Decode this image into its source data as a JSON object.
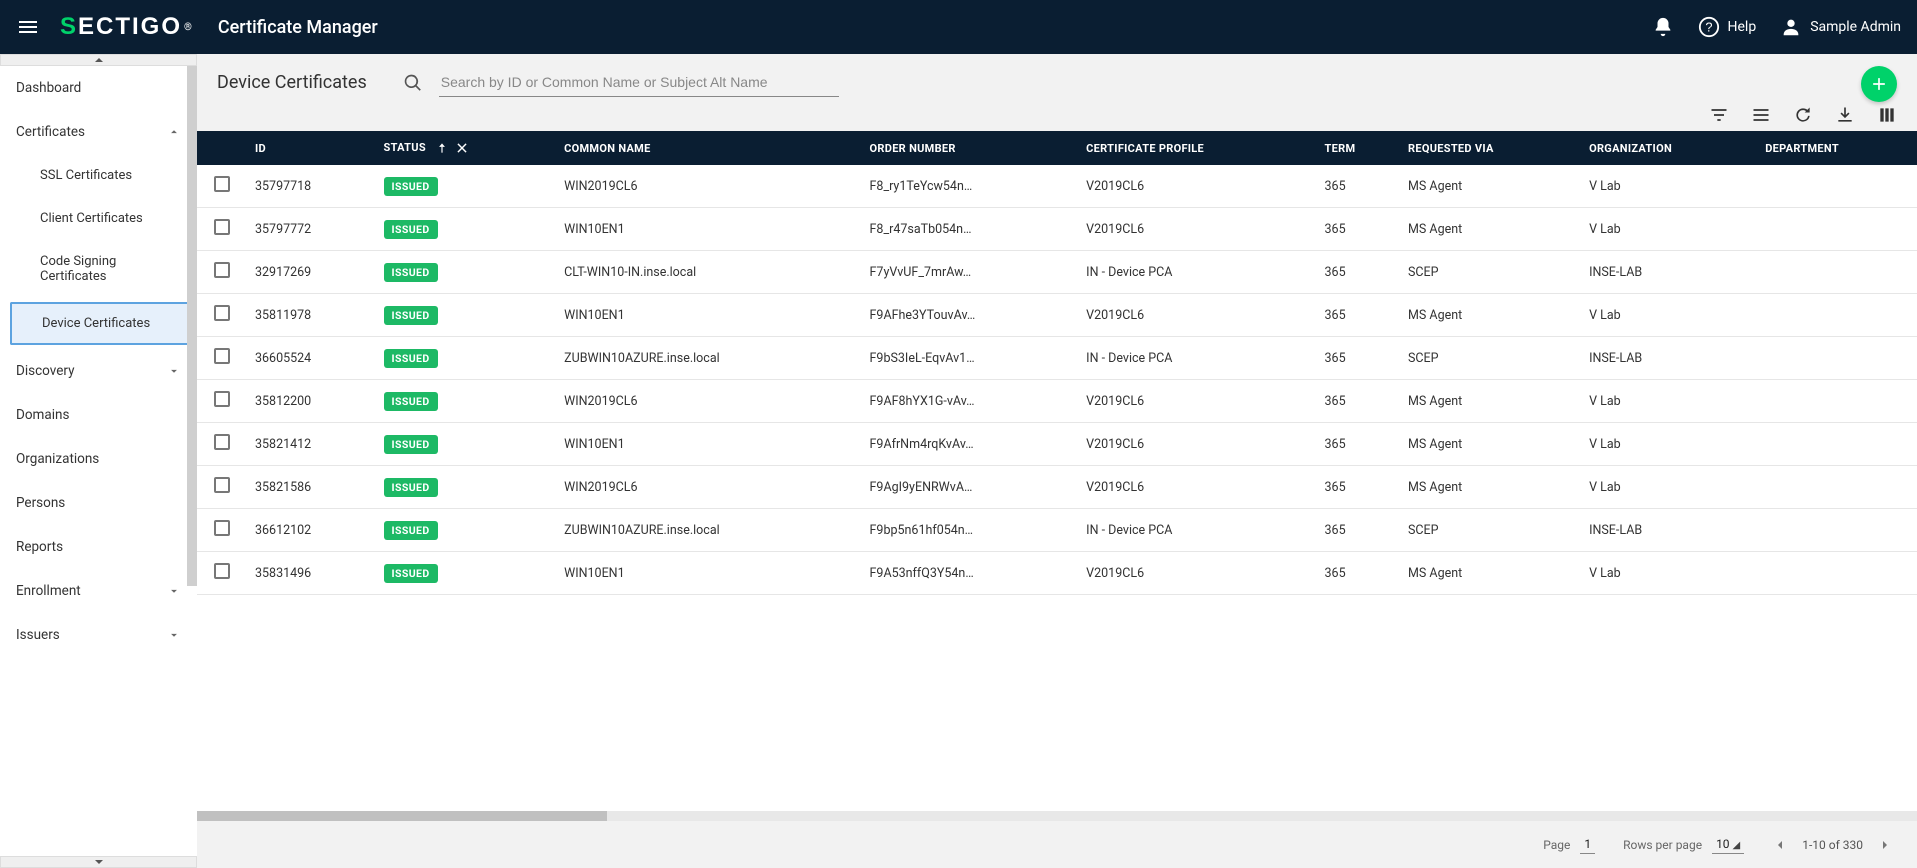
{
  "brand": {
    "green": "S",
    "rest": "ECTIGO",
    "trademark": "®"
  },
  "app_title": "Certificate Manager",
  "top_right": {
    "help": "Help",
    "username": "Sample Admin"
  },
  "sidebar": {
    "items": [
      {
        "label": "Dashboard",
        "type": "item"
      },
      {
        "label": "Certificates",
        "type": "expand",
        "expanded": true,
        "children": [
          {
            "label": "SSL Certificates"
          },
          {
            "label": "Client Certificates"
          },
          {
            "label": "Code Signing Certificates"
          },
          {
            "label": "Device Certificates",
            "active": true
          }
        ]
      },
      {
        "label": "Discovery",
        "type": "expand",
        "expanded": false
      },
      {
        "label": "Domains",
        "type": "item"
      },
      {
        "label": "Organizations",
        "type": "item"
      },
      {
        "label": "Persons",
        "type": "item"
      },
      {
        "label": "Reports",
        "type": "item"
      },
      {
        "label": "Enrollment",
        "type": "expand",
        "expanded": false
      },
      {
        "label": "Issuers",
        "type": "expand",
        "expanded": false
      }
    ]
  },
  "page": {
    "title": "Device Certificates",
    "search_placeholder": "Search by ID or Common Name or Subject Alt Name"
  },
  "table": {
    "columns": [
      "ID",
      "STATUS",
      "COMMON NAME",
      "ORDER NUMBER",
      "CERTIFICATE PROFILE",
      "TERM",
      "REQUESTED VIA",
      "ORGANIZATION",
      "DEPARTMENT"
    ],
    "rows": [
      {
        "id": "35797718",
        "status": "ISSUED",
        "common_name": "WIN2019CL6",
        "order": "F8_ry1TeYcw54n…",
        "profile": "V2019CL6",
        "term": "365",
        "via": "MS Agent",
        "org": "V Lab",
        "dept": ""
      },
      {
        "id": "35797772",
        "status": "ISSUED",
        "common_name": "WIN10EN1",
        "order": "F8_r47saTb054n…",
        "profile": "V2019CL6",
        "term": "365",
        "via": "MS Agent",
        "org": "V Lab",
        "dept": ""
      },
      {
        "id": "32917269",
        "status": "ISSUED",
        "common_name": "CLT-WIN10-IN.inse.local",
        "order": "F7yVvUF_7mrAw…",
        "profile": "IN - Device PCA",
        "term": "365",
        "via": "SCEP",
        "org": "INSE-LAB",
        "dept": ""
      },
      {
        "id": "35811978",
        "status": "ISSUED",
        "common_name": "WIN10EN1",
        "order": "F9AFhe3YTouvAv…",
        "profile": "V2019CL6",
        "term": "365",
        "via": "MS Agent",
        "org": "V Lab",
        "dept": ""
      },
      {
        "id": "36605524",
        "status": "ISSUED",
        "common_name": "ZUBWIN10AZURE.inse.local",
        "order": "F9bS3IeL-EqvAv1…",
        "profile": "IN - Device PCA",
        "term": "365",
        "via": "SCEP",
        "org": "INSE-LAB",
        "dept": ""
      },
      {
        "id": "35812200",
        "status": "ISSUED",
        "common_name": "WIN2019CL6",
        "order": "F9AF8hYX1G-vAv…",
        "profile": "V2019CL6",
        "term": "365",
        "via": "MS Agent",
        "org": "V Lab",
        "dept": ""
      },
      {
        "id": "35821412",
        "status": "ISSUED",
        "common_name": "WIN10EN1",
        "order": "F9AfrNm4rqKvAv…",
        "profile": "V2019CL6",
        "term": "365",
        "via": "MS Agent",
        "org": "V Lab",
        "dept": ""
      },
      {
        "id": "35821586",
        "status": "ISSUED",
        "common_name": "WIN2019CL6",
        "order": "F9AgI9yENRWvA…",
        "profile": "V2019CL6",
        "term": "365",
        "via": "MS Agent",
        "org": "V Lab",
        "dept": ""
      },
      {
        "id": "36612102",
        "status": "ISSUED",
        "common_name": "ZUBWIN10AZURE.inse.local",
        "order": "F9bp5n61hf054n…",
        "profile": "IN - Device PCA",
        "term": "365",
        "via": "SCEP",
        "org": "INSE-LAB",
        "dept": ""
      },
      {
        "id": "35831496",
        "status": "ISSUED",
        "common_name": "WIN10EN1",
        "order": "F9A53nffQ3Y54n…",
        "profile": "V2019CL6",
        "term": "365",
        "via": "MS Agent",
        "org": "V Lab",
        "dept": ""
      }
    ]
  },
  "paginator": {
    "page_label": "Page",
    "page_value": "1",
    "rpp_label": "Rows per page",
    "rpp_value": "10",
    "range": "1-10 of 330"
  },
  "icons": {
    "filter": "filter-icon",
    "group": "group-icon",
    "refresh": "refresh-icon",
    "download": "download-icon",
    "columns": "columns-icon"
  }
}
